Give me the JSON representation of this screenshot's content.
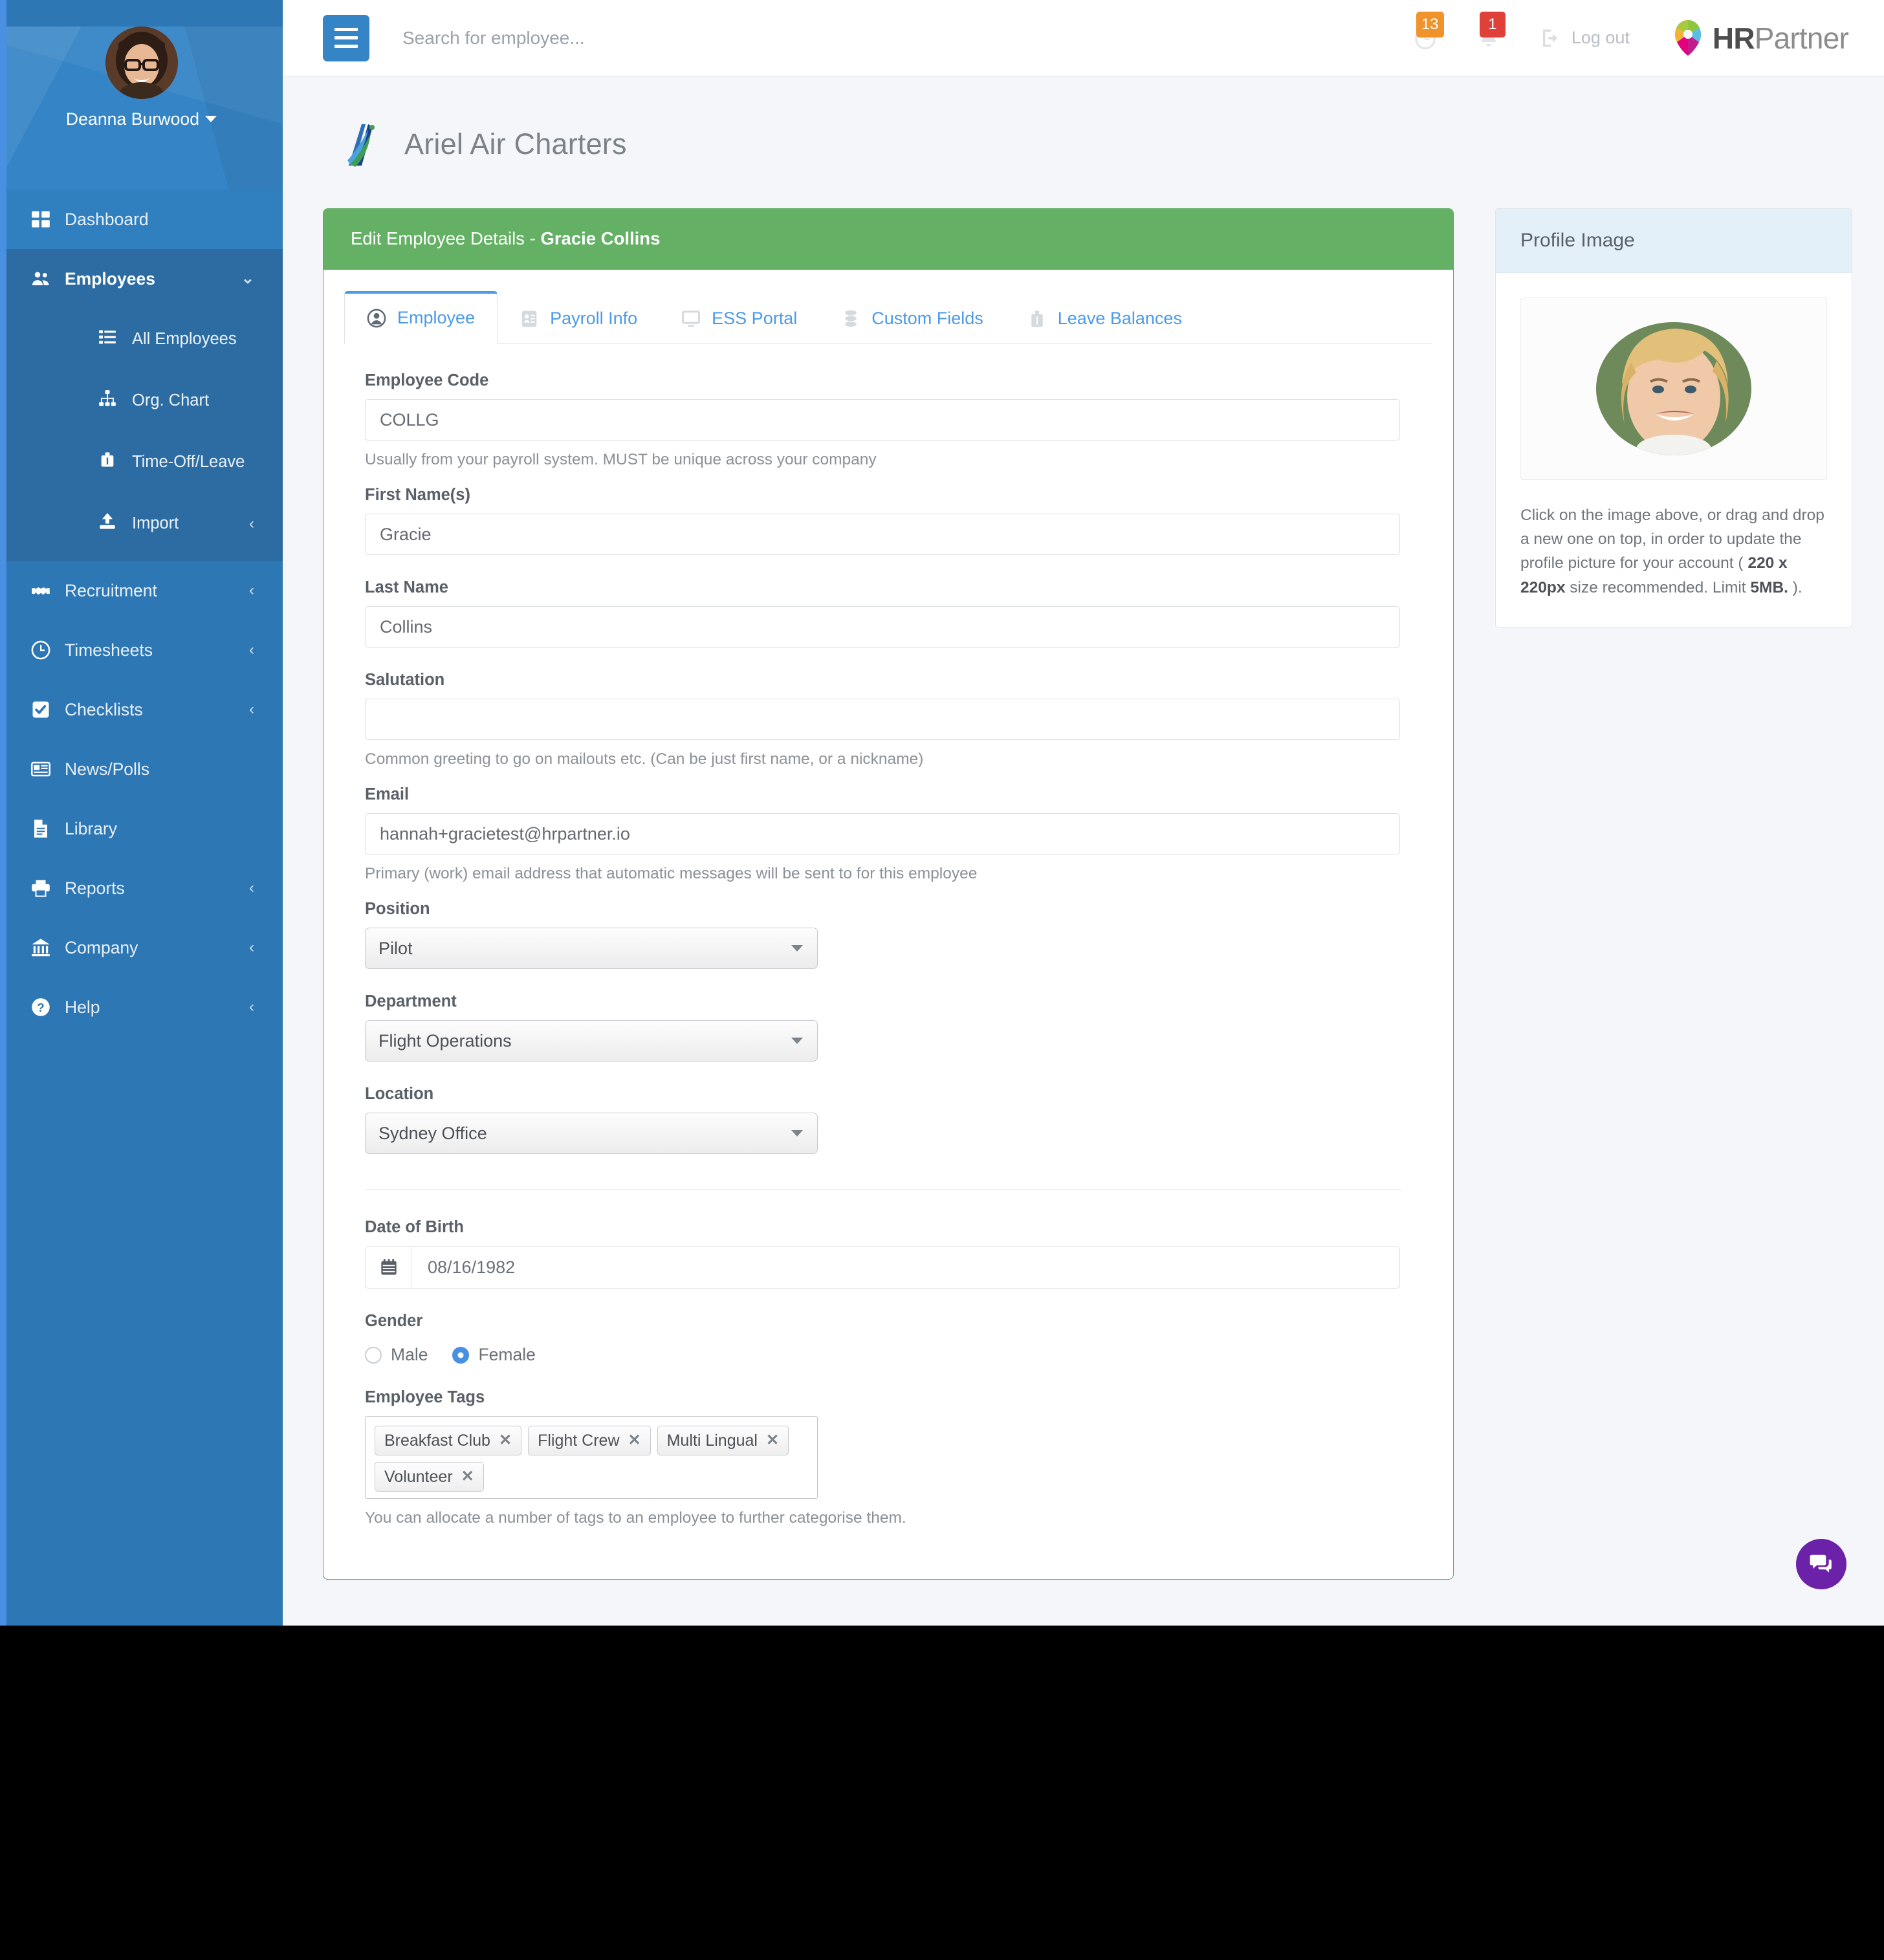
{
  "topbar": {
    "search_placeholder": "Search for employee...",
    "hamburger_label": "Toggle navigation",
    "tasks_badge": "13",
    "notifications_badge": "1",
    "logout_label": "Log out",
    "brand_part1": "HR",
    "brand_part2": "Partner"
  },
  "sidebar": {
    "user_name": "Deanna Burwood",
    "items": [
      {
        "label": "Dashboard",
        "icon": "grid-icon",
        "arrow": "",
        "active": true
      },
      {
        "label": "Employees",
        "icon": "users-icon",
        "arrow": "chevron-down"
      },
      {
        "label": "All Employees",
        "icon": "list-icon",
        "arrow": ""
      },
      {
        "label": "Org. Chart",
        "icon": "sitemap-icon",
        "arrow": ""
      },
      {
        "label": "Time-Off/Leave",
        "icon": "briefcase-icon",
        "arrow": ""
      },
      {
        "label": "Import",
        "icon": "upload-icon",
        "arrow": "chevron-left"
      },
      {
        "label": "Recruitment",
        "icon": "handshake-icon",
        "arrow": "chevron-left"
      },
      {
        "label": "Timesheets",
        "icon": "clock-icon",
        "arrow": "chevron-left"
      },
      {
        "label": "Checklists",
        "icon": "check-square-icon",
        "arrow": "chevron-left"
      },
      {
        "label": "News/Polls",
        "icon": "newspaper-icon",
        "arrow": ""
      },
      {
        "label": "Library",
        "icon": "document-icon",
        "arrow": ""
      },
      {
        "label": "Reports",
        "icon": "printer-icon",
        "arrow": "chevron-left"
      },
      {
        "label": "Company",
        "icon": "bank-icon",
        "arrow": "chevron-left"
      },
      {
        "label": "Help",
        "icon": "question-circle-icon",
        "arrow": "chevron-left"
      }
    ]
  },
  "page": {
    "company_name": "Ariel Air Charters",
    "card_title_prefix": "Edit Employee Details - ",
    "card_title_name": "Gracie Collins"
  },
  "tabs": [
    {
      "label": "Employee",
      "icon": "user-circle-icon",
      "active": true
    },
    {
      "label": "Payroll Info",
      "icon": "id-card-icon",
      "active": false
    },
    {
      "label": "ESS Portal",
      "icon": "desktop-icon",
      "active": false
    },
    {
      "label": "Custom Fields",
      "icon": "layers-icon",
      "active": false
    },
    {
      "label": "Leave Balances",
      "icon": "briefcase-icon",
      "active": false
    }
  ],
  "form": {
    "employee_code": {
      "label": "Employee Code",
      "value": "COLLG",
      "help": "Usually from your payroll system. MUST be unique across your company"
    },
    "first_name": {
      "label": "First Name(s)",
      "value": "Gracie"
    },
    "last_name": {
      "label": "Last Name",
      "value": "Collins"
    },
    "salutation": {
      "label": "Salutation",
      "value": "",
      "help": "Common greeting to go on mailouts etc. (Can be just first name, or a nickname)"
    },
    "email": {
      "label": "Email",
      "value": "hannah+gracietest@hrpartner.io",
      "help": "Primary (work) email address that automatic messages will be sent to for this employee"
    },
    "position": {
      "label": "Position",
      "value": "Pilot"
    },
    "department": {
      "label": "Department",
      "value": "Flight Operations"
    },
    "location": {
      "label": "Location",
      "value": "Sydney Office"
    },
    "date_of_birth": {
      "label": "Date of Birth",
      "value": "08/16/1982"
    },
    "gender": {
      "label": "Gender",
      "options": [
        {
          "label": "Male",
          "selected": false
        },
        {
          "label": "Female",
          "selected": true
        }
      ]
    },
    "employee_tags": {
      "label": "Employee Tags",
      "tags": [
        "Breakfast Club",
        "Flight Crew",
        "Multi Lingual",
        "Volunteer"
      ],
      "remove_glyph": "✕",
      "help": "You can allocate a number of tags to an employee to further categorise them."
    }
  },
  "profile_panel": {
    "title": "Profile Image",
    "note_part1": "Click on the image above, or drag and drop a new one on top, in order to update the profile picture for your account ( ",
    "note_bold1": "220 x 220px",
    "note_part2": " size recommended. Limit ",
    "note_bold2": "5MB.",
    "note_part3": " )."
  },
  "chat": {
    "label": "chat-icon"
  },
  "colors": {
    "sidebar_bg": "#2e77b5",
    "sidebar_profile_bg": "#3585c6",
    "sidebar_active_group": "#2c6ca3",
    "sidebar_accent": "#4a90e2",
    "card_header_green": "#64b064",
    "tab_blue": "#4a9ae8",
    "panel_header_blue": "#e3f0fa",
    "badge_orange": "#f0932b",
    "badge_red": "#e0403a",
    "chat_purple": "#6b21a8"
  }
}
